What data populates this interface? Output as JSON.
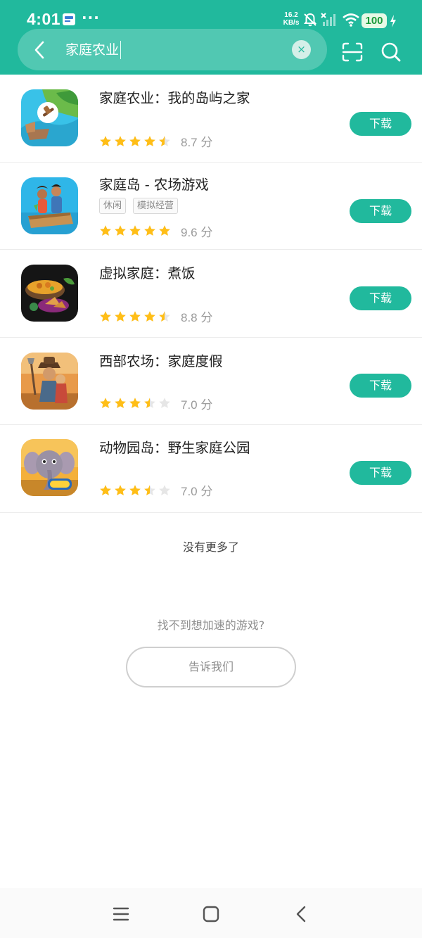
{
  "status_bar": {
    "time": "4:01",
    "more_indicator": "···",
    "net_speed_value": "16.2",
    "net_speed_unit": "KB/s",
    "battery": "100",
    "icons": [
      "notification-app-icon",
      "mute-icon",
      "signal-icon",
      "wifi-icon",
      "battery-icon",
      "charging-icon"
    ]
  },
  "search": {
    "query": "家庭农业",
    "clear_icon": "×"
  },
  "results": [
    {
      "name": "家庭农业：我的岛屿之家",
      "tags": [],
      "rating": 4.5,
      "score_text": "8.7 分",
      "button": "下载",
      "icon_colors": [
        "#35c1e6",
        "#5fb24a"
      ]
    },
    {
      "name": "家庭岛 - 农场游戏",
      "tags": [
        "休闲",
        "模拟经营"
      ],
      "rating": 5,
      "score_text": "9.6 分",
      "button": "下载",
      "icon_colors": [
        "#2fb6e8",
        "#d9a24a"
      ]
    },
    {
      "name": "虚拟家庭：煮饭",
      "tags": [],
      "rating": 4.5,
      "score_text": "8.8 分",
      "button": "下载",
      "icon_colors": [
        "#151515",
        "#e7a22b"
      ]
    },
    {
      "name": "西部农场：家庭度假",
      "tags": [],
      "rating": 3.5,
      "score_text": "7.0 分",
      "button": "下载",
      "icon_colors": [
        "#e28a3d",
        "#6a4a32"
      ]
    },
    {
      "name": "动物园岛：野生家庭公园",
      "tags": [],
      "rating": 3.5,
      "score_text": "7.0 分",
      "button": "下载",
      "icon_colors": [
        "#f0a62b",
        "#8f8a98"
      ]
    }
  ],
  "footer": {
    "no_more": "没有更多了",
    "cant_find": "找不到想加速的游戏?",
    "tell_us": "告诉我们"
  },
  "colors": {
    "accent": "#21b99d",
    "star": "#ffbe17",
    "star_empty": "#e6e6e6"
  }
}
